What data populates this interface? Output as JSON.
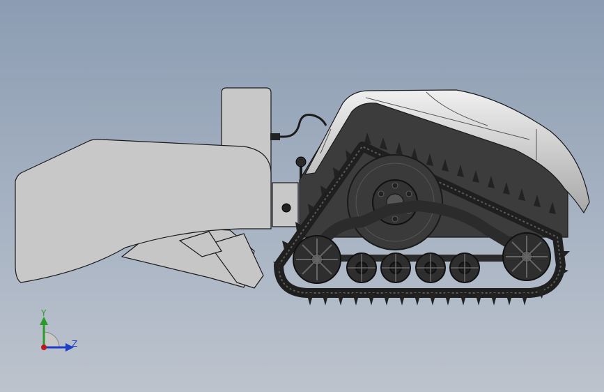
{
  "viewport": {
    "background_top": "#8c9cb2",
    "background_bottom": "#bcc3cd"
  },
  "model": {
    "body_color": "#c8c8c8",
    "track_color": "#3a3a3a",
    "edge_color": "#1a1a1a"
  },
  "triad": {
    "y_label": "Y",
    "z_label": "Z",
    "y_color": "#2a9a2a",
    "z_color": "#1e3ec8",
    "origin_color": "#c01818"
  }
}
